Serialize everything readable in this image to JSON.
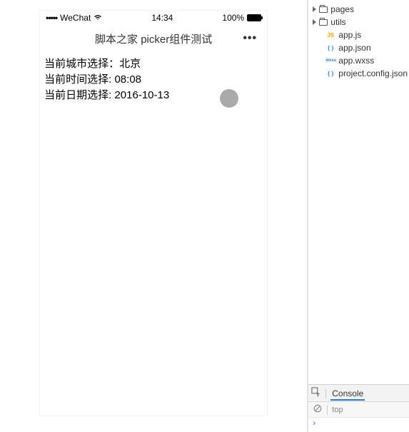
{
  "statusbar": {
    "carrier": "WeChat",
    "time": "14:34",
    "battery_pct": "100%"
  },
  "navbar": {
    "title": "脚本之家 picker组件测试",
    "more": "•••"
  },
  "page": {
    "city_label": "当前城市选择：",
    "city_value": "北京",
    "time_label": "当前时间选择: ",
    "time_value": "08:08",
    "date_label": "当前日期选择: ",
    "date_value": "2016-10-13"
  },
  "tree": {
    "folders": [
      {
        "name": "pages"
      },
      {
        "name": "utils"
      }
    ],
    "files": [
      {
        "icon": "JS",
        "cls": "ic-js",
        "name": "app.js"
      },
      {
        "icon": "{ }",
        "cls": "ic-json",
        "name": "app.json"
      },
      {
        "icon": "wxss",
        "cls": "ic-wxss",
        "name": "app.wxss"
      },
      {
        "icon": "{ }",
        "cls": "ic-json",
        "name": "project.config.json"
      }
    ]
  },
  "console": {
    "tab": "Console",
    "filter": "top",
    "prompt": "›"
  }
}
